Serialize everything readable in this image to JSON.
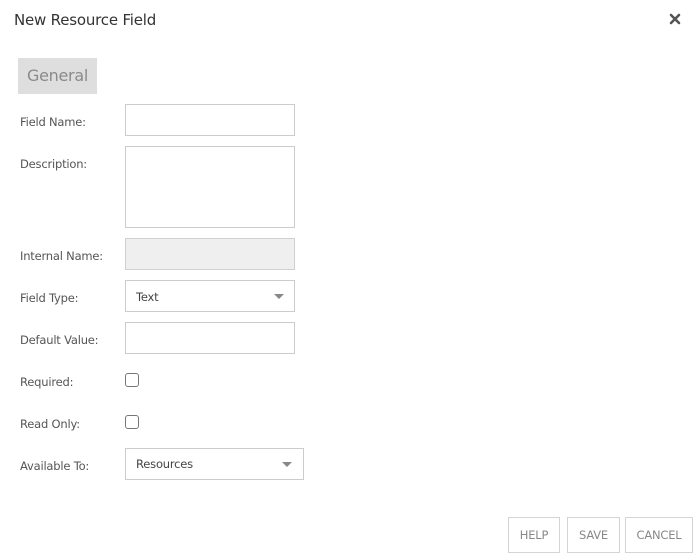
{
  "dialog": {
    "title": "New Resource Field",
    "close_icon": "close-icon"
  },
  "tabs": [
    {
      "label": "General",
      "active": true
    }
  ],
  "form": {
    "field_name": {
      "label": "Field Name:",
      "value": ""
    },
    "description": {
      "label": "Description:",
      "value": ""
    },
    "internal_name": {
      "label": "Internal Name:",
      "value": "",
      "disabled": true
    },
    "field_type": {
      "label": "Field Type:",
      "value": "Text"
    },
    "default_value": {
      "label": "Default Value:",
      "value": ""
    },
    "required": {
      "label": "Required:",
      "checked": false
    },
    "read_only": {
      "label": "Read Only:",
      "checked": false
    },
    "available_to": {
      "label": "Available To:",
      "value": "Resources"
    }
  },
  "footer": {
    "help_label": "HELP",
    "save_label": "SAVE",
    "cancel_label": "CANCEL"
  }
}
